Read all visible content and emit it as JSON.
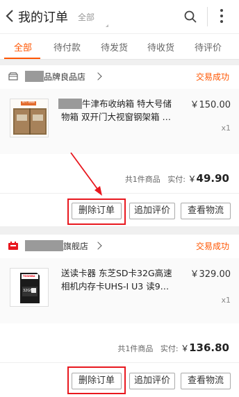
{
  "header": {
    "title": "我的订单",
    "filter_label": "全部"
  },
  "tabs": [
    {
      "label": "全部"
    },
    {
      "label": "待付款"
    },
    {
      "label": "待发货"
    },
    {
      "label": "待收货"
    },
    {
      "label": "待评价"
    }
  ],
  "orders": [
    {
      "shop_name": "品牌良品店",
      "status": "交易成功",
      "product_name": "牛津布收纳箱 特大号储物箱 双开门大视窗钢架箱 …",
      "thumb_label": "前开门收纳箱",
      "price": "￥150.00",
      "quantity": "x1",
      "summary_count": "共1件商品",
      "summary_paid_label": "实付:",
      "summary_currency": "￥",
      "summary_amount": "49.90",
      "buttons": [
        "删除订单",
        "追加评价",
        "查看物流"
      ]
    },
    {
      "shop_name": "旗舰店",
      "status": "交易成功",
      "product_name": "送读卡器 东芝SD卡32G高速相机内存卡UHS-I U3 读9…",
      "thumb_label": "TOSHIBA",
      "thumb_capacity": "32GB",
      "price": "￥329.00",
      "quantity": "x1",
      "summary_count": "共1件商品",
      "summary_paid_label": "实付:",
      "summary_currency": "￥",
      "summary_amount": "136.80",
      "buttons": [
        "删除订单",
        "追加评价",
        "查看物流"
      ]
    }
  ],
  "colors": {
    "accent": "#ff5500",
    "highlight": "#e8171e"
  }
}
